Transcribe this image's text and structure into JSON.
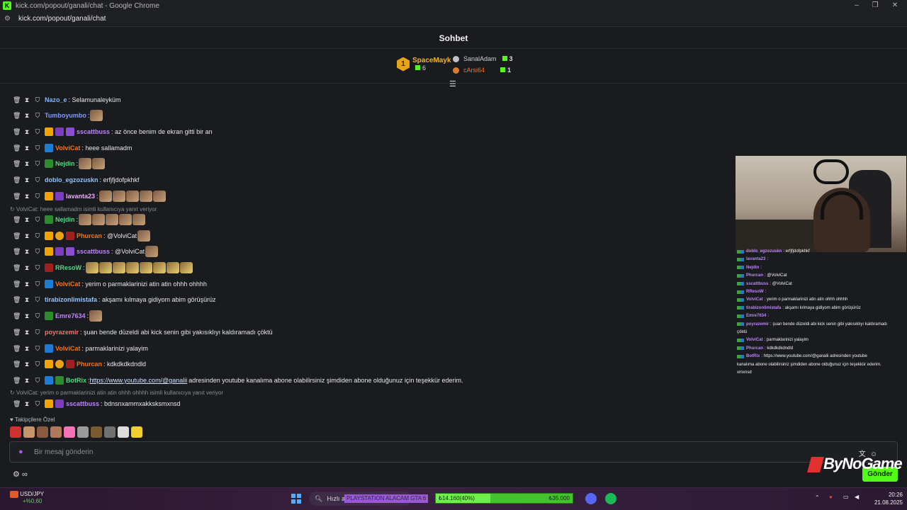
{
  "window": {
    "title": "kick.com/popout/ganali/chat - Google Chrome",
    "url": "kick.com/popout/ganali/chat"
  },
  "chat": {
    "title": "Sohbet"
  },
  "leaderboard": {
    "first": {
      "rank": "1",
      "name": "SpaceMayk",
      "count": "6"
    },
    "second": {
      "name": "SanalAdam",
      "count": "3"
    },
    "third": {
      "name": "cArsi64",
      "count": "1"
    }
  },
  "messages": [
    {
      "user": "Nazo_e",
      "color": "#7fb6ff",
      "text": ": Selamunaleyküm"
    },
    {
      "user": "Tumboyumbo",
      "color": "#7f9cff",
      "text": ":"
    },
    {
      "user": "sscattbuss",
      "color": "#c084fc",
      "text": ": az önce benim de ekran gitti bir an"
    },
    {
      "user": "VolviCat",
      "color": "#f97316",
      "text": ": heee sallamadm"
    },
    {
      "user": "Nejdin",
      "color": "#4ade80",
      "text": ":"
    },
    {
      "user": "doblo_egzozuskn",
      "color": "#93c5fd",
      "text": ": erfjfjdofpkhkf"
    },
    {
      "user": "lavanta23",
      "color": "#f0abfc",
      "text": ":"
    },
    {
      "user": "Nejdin",
      "color": "#4ade80",
      "text": ":"
    },
    {
      "user": "Phurcan",
      "color": "#f97316",
      "text": ": @VolviCat"
    },
    {
      "user": "sscattbuss",
      "color": "#c084fc",
      "text": ": @VolviCat"
    },
    {
      "user": "RResoW",
      "color": "#4ade80",
      "text": ":"
    },
    {
      "user": "VolviCat",
      "color": "#f97316",
      "text": ": yerim o parmaklarinizi atin atin ohhh ohhhh"
    },
    {
      "user": "tirabizonlimistafa",
      "color": "#93c5fd",
      "text": ": akşamı kılmaya gidiyom abim görüşürüz"
    },
    {
      "user": "Emre7634",
      "color": "#c084fc",
      "text": ":"
    },
    {
      "user": "poyrazemir",
      "color": "#f87171",
      "text": ": şuan bende düzeldi abi kick senin gibi yakısıklıyı kaldıramadı çöktü"
    },
    {
      "user": "VolviCat",
      "color": "#f97316",
      "text": ": parmaklarinizi yalayim"
    },
    {
      "user": "Phurcan",
      "color": "#f97316",
      "text": ": kdkdkdkdndld"
    },
    {
      "user": "BotRix",
      "color": "#4ade80",
      "text": ":",
      "link": "https://www.youtube.com/@ganalii",
      "after": " adresinden youtube kanalıma abone olabilirsiniz şimdiden abone olduğunuz için teşekkür ederim."
    },
    {
      "user": "sscattbuss",
      "color": "#c084fc",
      "text": ": bdnsnxammxakksksmxnsd"
    }
  ],
  "replies": [
    "VolviCat: heee sallamadm isimli kullanıcıya yanıt veriyor",
    "VolviCat: yerim o parmaklarinizi atin atin ohhh ohhhh isimli kullanıcıya yanıt veriyor"
  ],
  "followers_label": "Takipçilere Özel",
  "input": {
    "placeholder": "Bir mesaj gönderin",
    "send": "Gönder"
  },
  "overlay": {
    "lines": [
      {
        "user": "doblo_egzozuskn",
        "text": ": erfjfjdofpkhkf"
      },
      {
        "user": "lavanta23",
        "text": ":"
      },
      {
        "user": "Nejdin",
        "text": ":"
      },
      {
        "user": "Phurcan",
        "text": ": @VolviCat"
      },
      {
        "user": "sscattbuss",
        "text": ": @VolviCat"
      },
      {
        "user": "RResoW",
        "text": ":"
      },
      {
        "user": "VolviCat",
        "text": ": yerim o parmaklarinizi atin atin ohhh ohhhh"
      },
      {
        "user": "tirabizonlimistafa",
        "text": ": akşamı kılmaya gidiyom abim görüşürüz"
      },
      {
        "user": "Emre7634",
        "text": ":"
      },
      {
        "user": "poyrazemir",
        "text": ": şuan bende düzeldi abi kick senin gibi yakısıklıyı kaldıramadı"
      },
      {
        "user": "",
        "text": "çöktü"
      },
      {
        "user": "VolviCat",
        "text": ": parmaklarinizi yalayim"
      },
      {
        "user": "Phurcan",
        "text": ": kdkdkdkdndld"
      },
      {
        "user": "BotRix",
        "text": ": https://www.youtube.com/@ganalii adresinden youtube"
      },
      {
        "user": "",
        "text": "kanalıma abone olabilirsiniz şimdiden abone olduğunuz için teşekkür ederim."
      },
      {
        "user": "",
        "text": "xmxnsd"
      }
    ]
  },
  "brand": "ByNoGame",
  "taskbar": {
    "ticker": "USD/JPY",
    "ticker_change": "+%0,60",
    "search": "Hızlı a",
    "overlay_text": "PLAYSTATION ALACAM GTA 6",
    "donation_current": "₺14.160(40%)",
    "donation_goal": "₺35.000",
    "donation_progress": 0.4,
    "time": "20:26",
    "date": "21.08.2025"
  }
}
